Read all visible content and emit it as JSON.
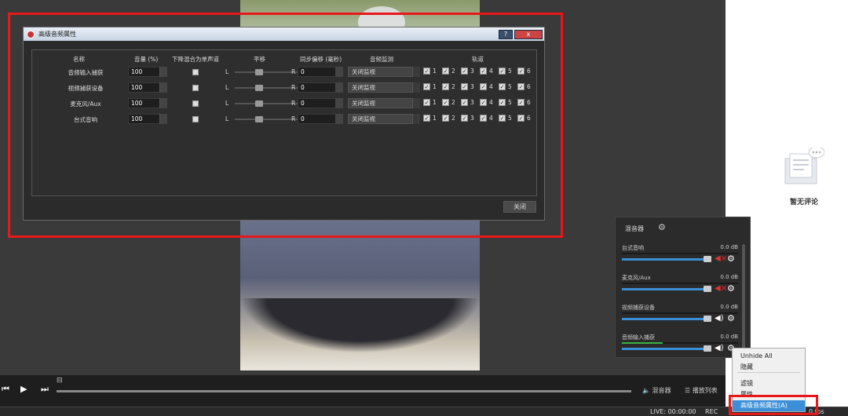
{
  "dialog": {
    "title": "高级音频属性",
    "help_button": "?",
    "close_x": "x",
    "close_button": "关闭",
    "headers": {
      "name": "名称",
      "volume": "音量 (%)",
      "downmix": "下降混合为单声道",
      "pan": "平移",
      "sync": "同步偏移 (毫秒)",
      "monitor": "音频监测",
      "tracks": "轨道"
    },
    "pan_left": "L",
    "pan_right": "R",
    "track_numbers": [
      "1",
      "2",
      "3",
      "4",
      "5",
      "6"
    ],
    "rows": [
      {
        "name": "音频输入捕获",
        "volume": "100",
        "sync": "0",
        "monitor": "关闭监视"
      },
      {
        "name": "视频捕获设备",
        "volume": "100",
        "sync": "0",
        "monitor": "关闭监视"
      },
      {
        "name": "麦克风/Aux",
        "volume": "100",
        "sync": "0",
        "monitor": "关闭监视"
      },
      {
        "name": "台式音响",
        "volume": "100",
        "sync": "0",
        "monitor": "关闭监视"
      }
    ]
  },
  "mixer": {
    "title": "混音器",
    "channels": [
      {
        "name": "台式音响",
        "db": "0.0 dB",
        "level": 0.0
      },
      {
        "name": "麦克风/Aux",
        "db": "0.0 dB",
        "level": 0.0
      },
      {
        "name": "视频捕获设备",
        "db": "0.0 dB",
        "level": 0.0
      },
      {
        "name": "音频输入捕获",
        "db": "0.0 dB",
        "level": 0.35
      }
    ]
  },
  "context_menu": {
    "items": [
      "Unhide All",
      "隐藏",
      "滤镜",
      "属性"
    ],
    "selected": "高级音频属性(A)"
  },
  "player": {
    "mixer_label": "混音器",
    "playlist_label": "播放列表"
  },
  "status": {
    "live": "LIVE: 00:00:00",
    "rec": "REC",
    "fps": "0 fps"
  },
  "right_panel": {
    "no_comment": "暂无评论"
  },
  "colors": {
    "highlight_red": "#e8181a",
    "accent_blue": "#3b8fd8",
    "meter_green": "#3cb043"
  }
}
